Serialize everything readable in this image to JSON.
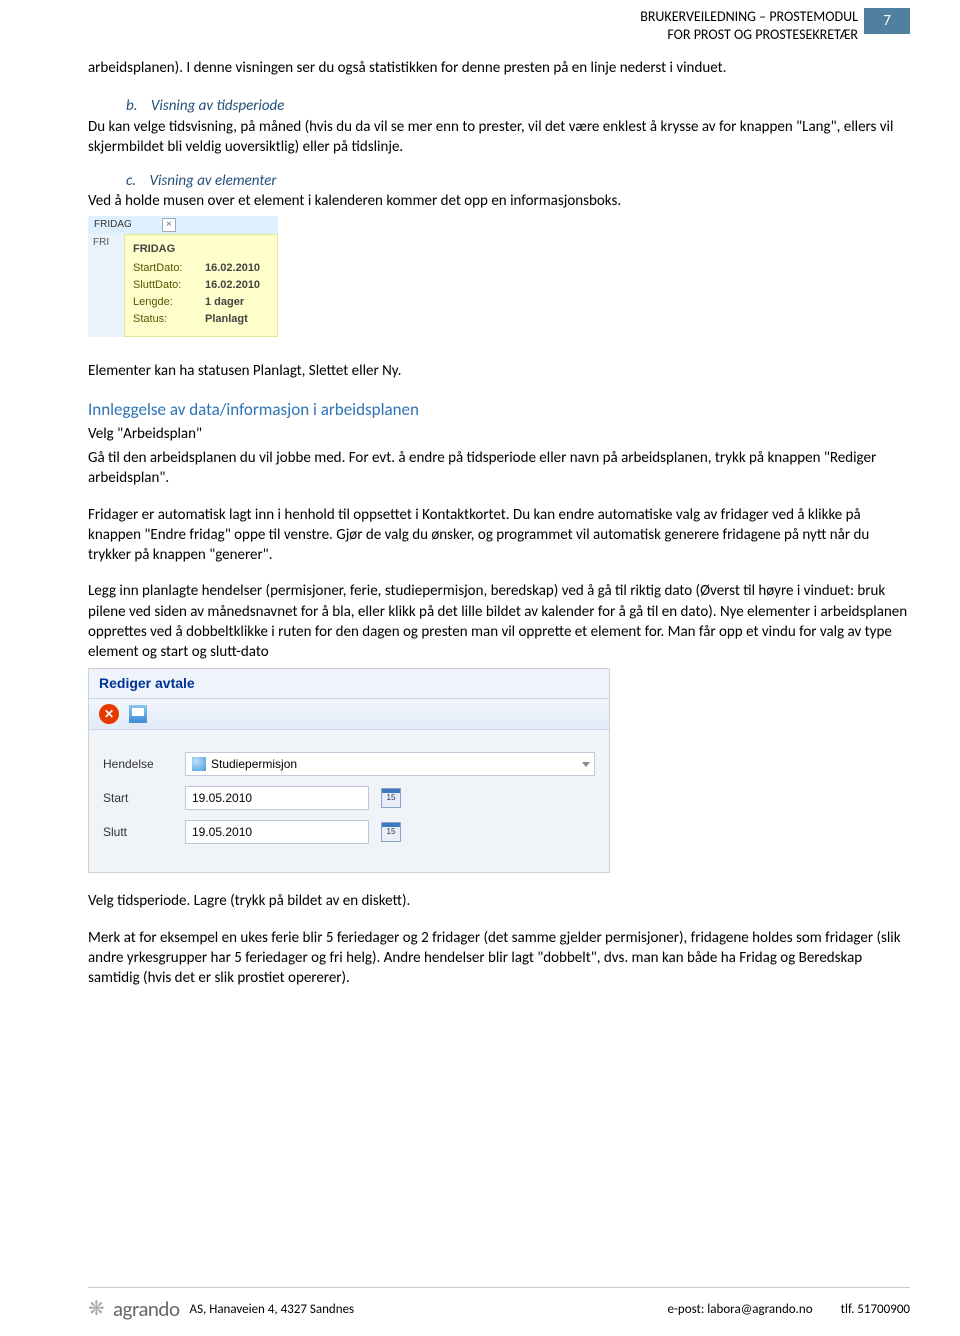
{
  "header": {
    "title_line1": "BRUKERVEILEDNING – PROSTEMODUL",
    "title_line2": "FOR PROST OG PROSTESEKRETÆR",
    "page_number": "7"
  },
  "intro": "arbeidsplanen). I denne visningen ser du også statistikken for denne presten på en linje nederst i vinduet.",
  "section_b": {
    "letter": "b.",
    "title": "Visning av tidsperiode",
    "body": "Du kan velge tidsvisning, på måned (hvis du da vil se mer enn to prester, vil det være enklest å krysse av for knappen \"Lang\", ellers vil skjermbildet bli veldig uoversiktlig) eller på tidslinje."
  },
  "section_c": {
    "letter": "c.",
    "title": "Visning av elementer",
    "body": "Ved å holde musen over et element i kalenderen kommer det opp en informasjonsboks."
  },
  "tooltip": {
    "top_label": "FRIDAG",
    "side_label": "FRI",
    "title": "FRIDAG",
    "rows": [
      {
        "label": "StartDato:",
        "value": "16.02.2010"
      },
      {
        "label": "SluttDato:",
        "value": "16.02.2010"
      },
      {
        "label": "Lengde:",
        "value": "1 dager"
      },
      {
        "label": "Status:",
        "value": "Planlagt"
      }
    ]
  },
  "after_tooltip": "Elementer kan ha statusen Planlagt, Slettet eller Ny.",
  "innleggelse": {
    "heading": "Innleggelse av data/informasjon i arbeidsplanen",
    "p1": "Velg \"Arbeidsplan\"",
    "p2": "Gå til den arbeidsplanen du vil jobbe med. For evt.  å endre på tidsperiode eller navn på arbeidsplanen, trykk på knappen \"Rediger arbeidsplan\".",
    "p3": "Fridager er automatisk lagt inn i henhold til oppsettet i Kontaktkortet.  Du kan endre automatiske valg av fridager ved å klikke på knappen \"Endre fridag\" oppe til venstre. Gjør de valg du ønsker, og programmet vil automatisk generere fridagene på nytt når du trykker på knappen \"generer\".",
    "p4": "Legg inn planlagte hendelser (permisjoner, ferie, studiepermisjon, beredskap) ved å gå til riktig dato (Øverst til høyre i vinduet: bruk pilene ved siden av månedsnavnet for å bla, eller klikk på det lille bildet av kalender for å gå til en dato). Nye elementer i arbeidsplanen opprettes ved å dobbeltklikke i ruten for den dagen og presten man vil opprette et element for. Man får opp et vindu for valg av type element og start og slutt-dato"
  },
  "edit_dialog": {
    "title": "Rediger avtale",
    "fields": {
      "hendelse": {
        "label": "Hendelse",
        "value": "Studiepermisjon"
      },
      "start": {
        "label": "Start",
        "value": "19.05.2010",
        "cal": "15"
      },
      "slutt": {
        "label": "Slutt",
        "value": "19.05.2010",
        "cal": "15"
      }
    }
  },
  "after_dialog": {
    "p1": "Velg tidsperiode.  Lagre (trykk på bildet av en diskett).",
    "p2": "Merk at for eksempel en ukes ferie blir 5 feriedager og 2 fridager (det samme gjelder permisjoner), fridagene holdes som fridager (slik andre yrkesgrupper har 5 feriedager og fri helg). Andre hendelser blir lagt \"dobbelt\", dvs. man kan både ha Fridag og Beredskap samtidig (hvis det er slik prostiet opererer)."
  },
  "footer": {
    "logo_text": "agrando",
    "address": "AS, Hanaveien 4, 4327 Sandnes",
    "email": "e-post: labora@agrando.no",
    "phone": "tlf.  51700900"
  }
}
